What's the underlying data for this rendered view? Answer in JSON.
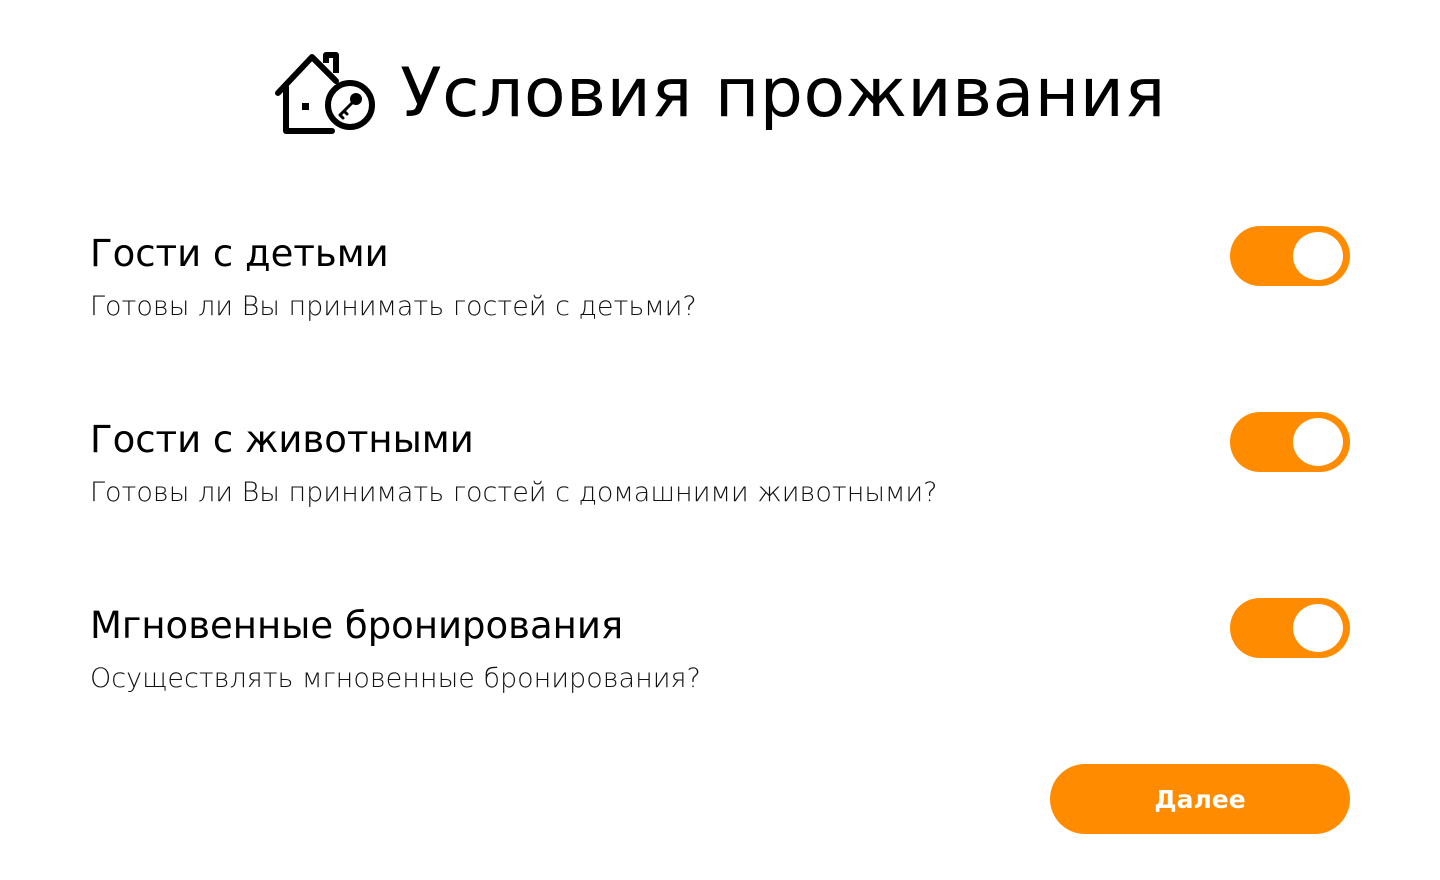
{
  "header": {
    "icon": "house-key-icon",
    "title": "Условия проживания"
  },
  "settings": [
    {
      "title": "Гости с детьми",
      "description": "Готовы ли Вы принимать гостей с детьми?",
      "enabled": true
    },
    {
      "title": "Гости с животными",
      "description": "Готовы ли Вы принимать гостей с домашними животными?",
      "enabled": true
    },
    {
      "title": "Мгновенные бронирования",
      "description": "Осуществлять мгновенные бронирования?",
      "enabled": true
    }
  ],
  "actions": {
    "next_label": "Далее"
  },
  "colors": {
    "accent": "#ff8c00",
    "text": "#000000",
    "background": "#ffffff"
  }
}
